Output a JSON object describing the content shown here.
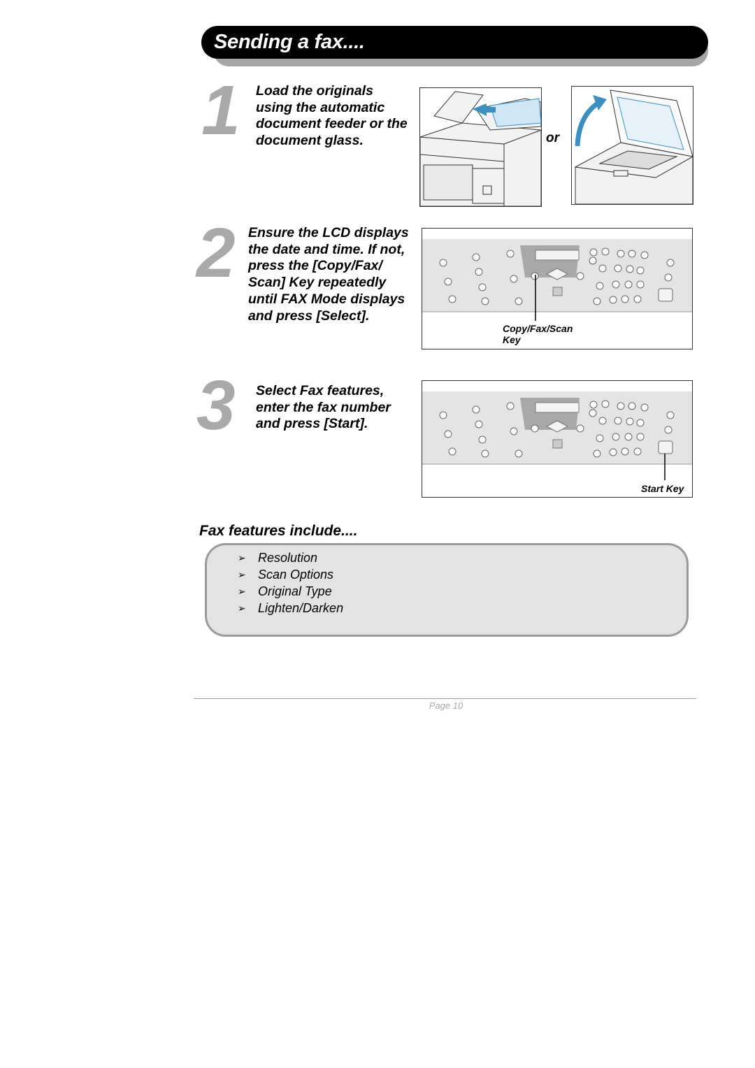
{
  "header": {
    "title": "Sending a fax...."
  },
  "steps": [
    {
      "number": "1",
      "lines": [
        "Load the originals",
        "using the automatic",
        "document feeder or the",
        "document glass."
      ]
    },
    {
      "number": "2",
      "lines": [
        "Ensure the LCD displays",
        "the date and time. If not,",
        "press the [Copy/Fax/",
        "Scan] Key repeatedly",
        "until FAX Mode displays",
        "and press [Select]."
      ]
    },
    {
      "number": "3",
      "lines": [
        "Select Fax features,",
        "enter the fax number",
        "and press [Start]."
      ]
    }
  ],
  "step1_images": {
    "or_label": "or"
  },
  "panel1": {
    "label_lines": [
      "Copy/Fax/Scan",
      "Key"
    ]
  },
  "panel2": {
    "label": "Start Key"
  },
  "features": {
    "title": "Fax features include....",
    "bullet_icon": "arrowhead-bullet",
    "items": [
      "Resolution",
      "Scan Options",
      "Original Type",
      "Lighten/Darken"
    ]
  },
  "footer": {
    "page": "Page 10"
  },
  "colors": {
    "accent_blue": "#3d8fc0",
    "numeral_gray": "#a9a9a9",
    "feature_box": "#e3e3e3"
  }
}
